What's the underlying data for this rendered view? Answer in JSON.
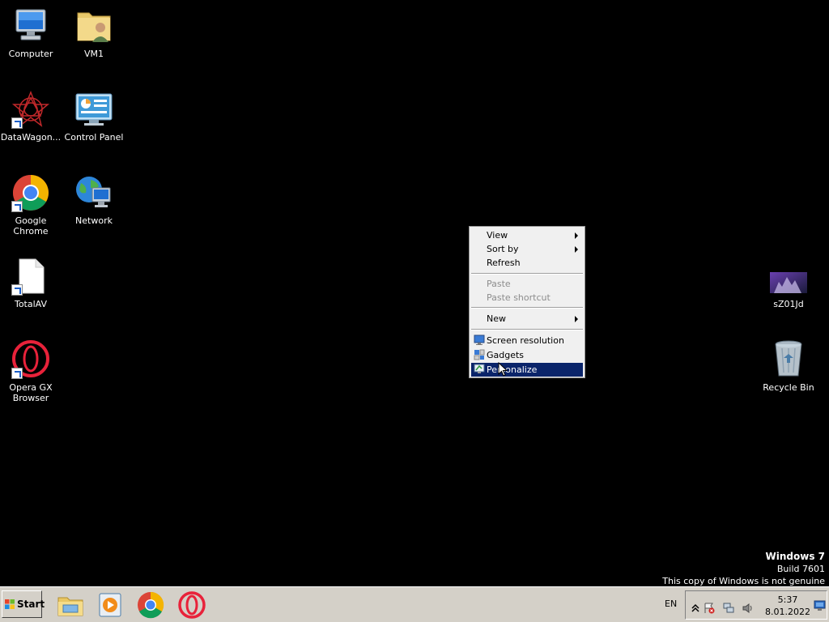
{
  "desktop_icons": [
    {
      "label": "Computer",
      "icon": "computer-icon"
    },
    {
      "label": "VM1",
      "icon": "user-folder-icon"
    },
    {
      "label": "DataWagon...",
      "icon": "datawagon-icon"
    },
    {
      "label": "Control Panel",
      "icon": "control-panel-icon"
    },
    {
      "label": "Google Chrome",
      "icon": "chrome-icon"
    },
    {
      "label": "Network",
      "icon": "network-icon"
    },
    {
      "label": "TotalAV",
      "icon": "file-icon"
    },
    {
      "label": "Opera GX\nBrowser",
      "icon": "opera-gx-icon"
    },
    {
      "label": "sZ01Jd",
      "icon": "image-thumbnail-icon"
    },
    {
      "label": "Recycle Bin",
      "icon": "recycle-bin-icon"
    }
  ],
  "context_menu": {
    "items": [
      {
        "label": "View",
        "submenu": true
      },
      {
        "label": "Sort by",
        "submenu": true
      },
      {
        "label": "Refresh"
      },
      {
        "label": "Paste",
        "disabled": true
      },
      {
        "label": "Paste shortcut",
        "disabled": true
      },
      {
        "label": "New",
        "submenu": true
      },
      {
        "label": "Screen resolution",
        "icon": "screen-resolution-icon"
      },
      {
        "label": "Gadgets",
        "icon": "gadgets-icon"
      },
      {
        "label": "Personalize",
        "icon": "personalize-icon",
        "highlighted": true
      }
    ]
  },
  "watermark": {
    "os": "Windows 7",
    "build": "Build 7601",
    "notice": "This copy of Windows is not genuine"
  },
  "taskbar": {
    "start_label": "Start",
    "pinned": [
      "explorer-icon",
      "media-player-icon",
      "chrome-icon",
      "opera-icon"
    ],
    "language": "EN",
    "time": "5:37",
    "date": "8.01.2022"
  },
  "colors": {
    "desktop_bg": "#000000",
    "taskbar_bg": "#d4d0c8",
    "menu_highlight": "#0a246a"
  }
}
